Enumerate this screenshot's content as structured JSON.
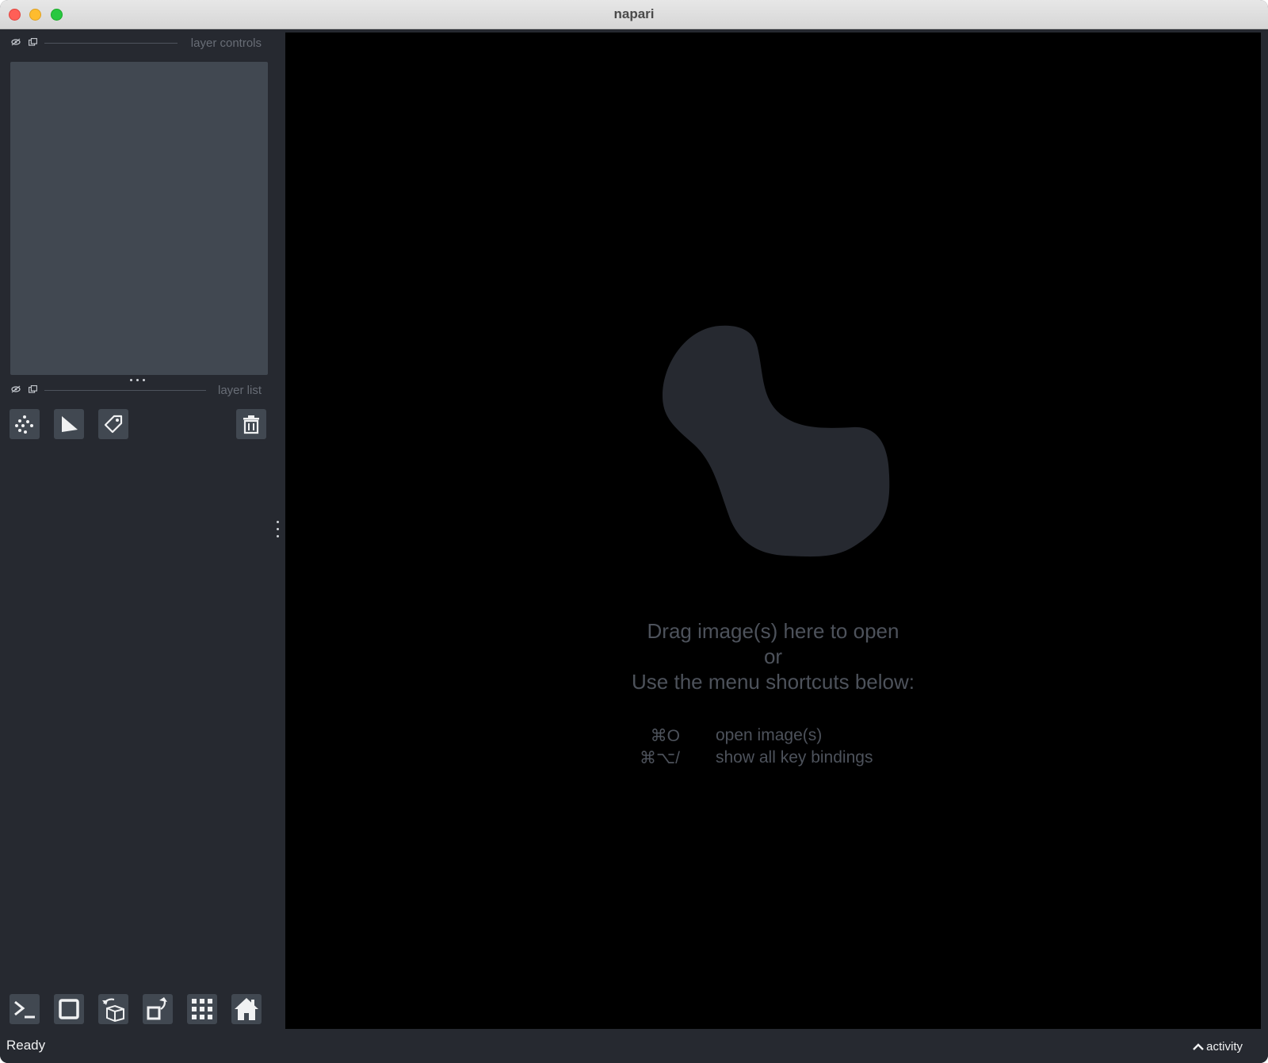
{
  "window": {
    "title": "napari"
  },
  "left_panel": {
    "layer_controls_title": "layer controls",
    "layer_list_title": "layer list",
    "layer_buttons": [
      {
        "name": "new-points-layer-button",
        "icon": "points-icon"
      },
      {
        "name": "new-shapes-layer-button",
        "icon": "shapes-icon"
      },
      {
        "name": "new-labels-layer-button",
        "icon": "label-tag-icon"
      },
      {
        "name": "delete-layer-button",
        "icon": "trash-icon"
      }
    ],
    "viewer_buttons": [
      {
        "name": "console-button",
        "icon": "console-icon"
      },
      {
        "name": "ndisplay-button",
        "icon": "square-icon"
      },
      {
        "name": "roll-dims-button",
        "icon": "cube-rotate-icon"
      },
      {
        "name": "transpose-dims-button",
        "icon": "transpose-icon"
      },
      {
        "name": "grid-view-button",
        "icon": "grid-icon"
      },
      {
        "name": "home-button",
        "icon": "home-icon"
      }
    ]
  },
  "canvas": {
    "welcome_line1": "Drag image(s) here to open",
    "welcome_line2": "or",
    "welcome_line3": "Use the menu shortcuts below:",
    "shortcuts": [
      {
        "key": "⌘O",
        "description": "open image(s)"
      },
      {
        "key": "⌘⌥/",
        "description": "show all key bindings"
      }
    ]
  },
  "status": {
    "text": "Ready",
    "activity_label": "activity"
  },
  "colors": {
    "panel_bg": "#262930",
    "control_bg": "#414851",
    "canvas_bg": "#000000",
    "muted_text": "#4d525b",
    "logo_fill": "#262930"
  }
}
